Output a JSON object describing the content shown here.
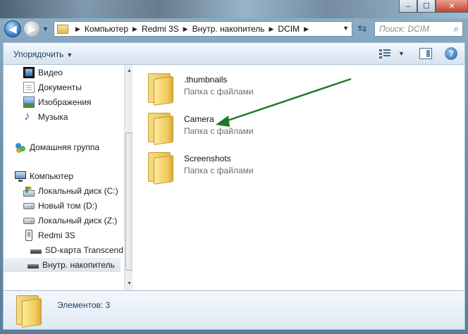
{
  "window": {
    "caption_buttons": [
      "minimize-icon",
      "maximize-icon",
      "close-icon"
    ]
  },
  "nav": {
    "back_icon": "back-arrow-icon",
    "forward_icon": "forward-arrow-icon",
    "breadcrumb": [
      "Компьютер",
      "Redmi 3S",
      "Внутр. накопитель",
      "DCIM"
    ],
    "refresh_icon": "refresh-icon",
    "search_placeholder": "Поиск: DCIM"
  },
  "toolbar": {
    "organize_label": "Упорядочить",
    "view_icon": "view-options-icon",
    "preview_pane_icon": "preview-pane-icon",
    "help_label": "?"
  },
  "sidebar": {
    "items": [
      {
        "label": "Видео",
        "icon": "video-library-icon"
      },
      {
        "label": "Документы",
        "icon": "documents-library-icon"
      },
      {
        "label": "Изображения",
        "icon": "pictures-library-icon"
      },
      {
        "label": "Музыка",
        "icon": "music-library-icon"
      },
      {
        "label": "Домашняя группа",
        "icon": "homegroup-icon"
      },
      {
        "label": "Компьютер",
        "icon": "computer-icon"
      },
      {
        "label": "Локальный диск (C:)",
        "icon": "system-disk-icon"
      },
      {
        "label": "Новый том (D:)",
        "icon": "disk-icon"
      },
      {
        "label": "Локальный диск (Z:)",
        "icon": "disk-icon"
      },
      {
        "label": "Redmi 3S",
        "icon": "phone-icon"
      },
      {
        "label": "SD-карта Transcend",
        "icon": "storage-icon"
      },
      {
        "label": "Внутр. накопитель",
        "icon": "storage-icon"
      }
    ],
    "selected": "Внутр. накопитель"
  },
  "content": {
    "folders": [
      {
        "name": ".thumbnails",
        "type": "Папка с файлами"
      },
      {
        "name": "Camera",
        "type": "Папка с файлами"
      },
      {
        "name": "Screenshots",
        "type": "Папка с файлами"
      }
    ],
    "annotation_arrow_color": "#1f7a1f"
  },
  "details": {
    "count_text": "Элементов: 3"
  },
  "colors": {
    "toolbar_bg": "#e3ecf5",
    "selected_item_bg": "#dfe4ea",
    "folder_yellow": "#f0cb5c"
  }
}
